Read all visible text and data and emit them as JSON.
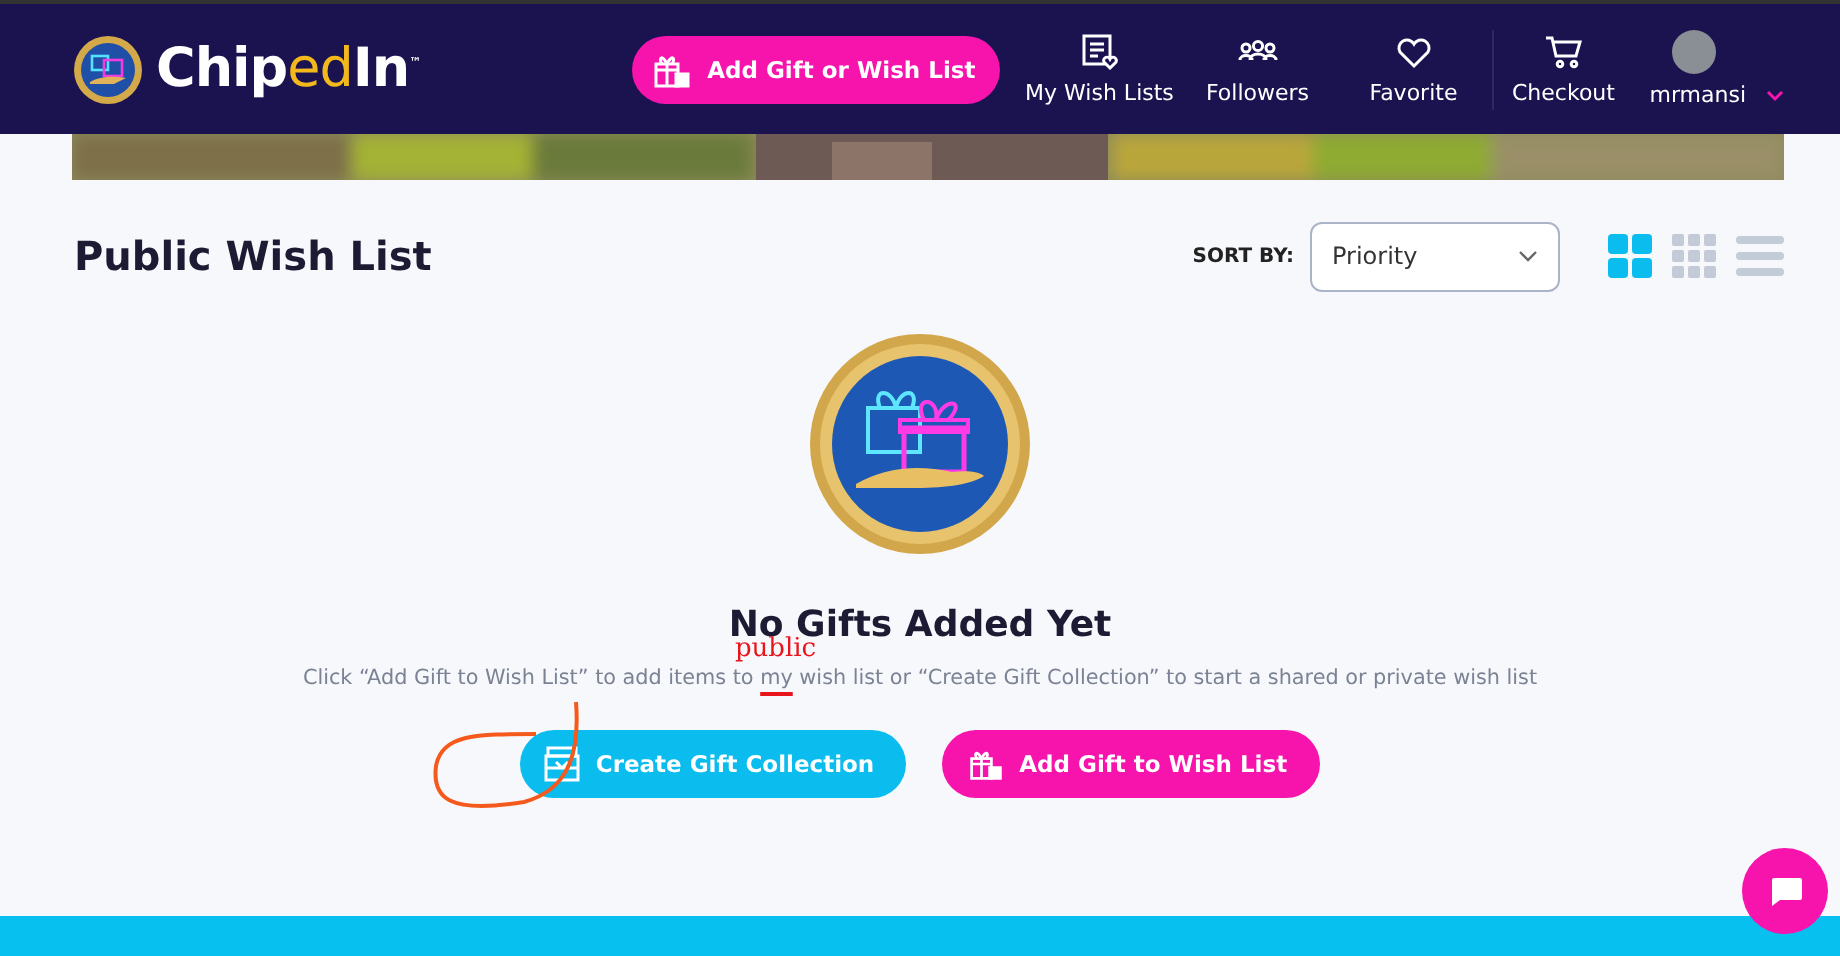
{
  "header": {
    "logo": {
      "parts": [
        {
          "text": "Chip",
          "accent": false
        },
        {
          "text": "ed",
          "accent": true
        },
        {
          "text": "In",
          "accent": false
        }
      ],
      "mark": "™"
    },
    "cta": "Add Gift or Wish List",
    "nav": [
      {
        "kind": "list",
        "label": "My Wish Lists"
      },
      {
        "kind": "people",
        "label": "Followers"
      },
      {
        "kind": "heart",
        "label": "Favorite"
      },
      {
        "kind": "cart",
        "label": "Checkout"
      }
    ],
    "user": {
      "name": "mrmansi"
    }
  },
  "page": {
    "title": "Public Wish List",
    "sort": {
      "label": "SORT BY:",
      "value": "Priority"
    },
    "views": [
      {
        "kind": "large-grid",
        "selected": true
      },
      {
        "kind": "small-grid",
        "selected": false
      },
      {
        "kind": "list",
        "selected": false
      }
    ]
  },
  "empty": {
    "title": "No Gifts Added Yet",
    "message": {
      "before": "Click “Add Gift to Wish List” to add items to ",
      "struck": "my",
      "after": " wish list or “Create Gift Collection” to start a shared or private wish list"
    },
    "annotation": "public",
    "buttons": [
      {
        "kind": "collection",
        "label": "Create Gift Collection"
      },
      {
        "kind": "gift",
        "label": "Add Gift to Wish List"
      }
    ]
  }
}
